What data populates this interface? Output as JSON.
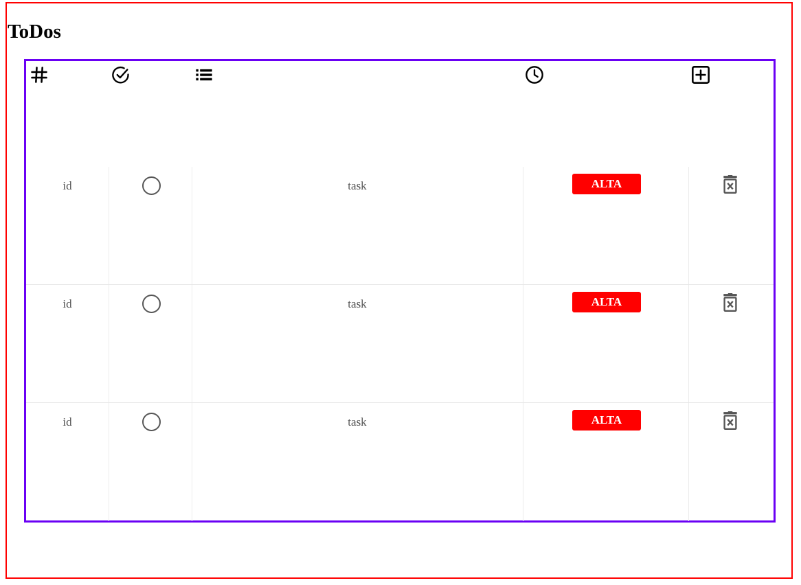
{
  "page": {
    "title": "ToDos"
  },
  "header": {
    "icons": [
      "hash-icon",
      "check-circle-icon",
      "list-icon",
      "clock-icon",
      "plus-square-icon"
    ]
  },
  "rows": [
    {
      "id": "id",
      "task": "task",
      "priority": "ALTA",
      "done": false
    },
    {
      "id": "id",
      "task": "task",
      "priority": "ALTA",
      "done": false
    },
    {
      "id": "id",
      "task": "task",
      "priority": "ALTA",
      "done": false
    }
  ],
  "colors": {
    "outer_border": "#ff0000",
    "table_border": "#6a00f4",
    "priority_high": "#ff0000"
  }
}
